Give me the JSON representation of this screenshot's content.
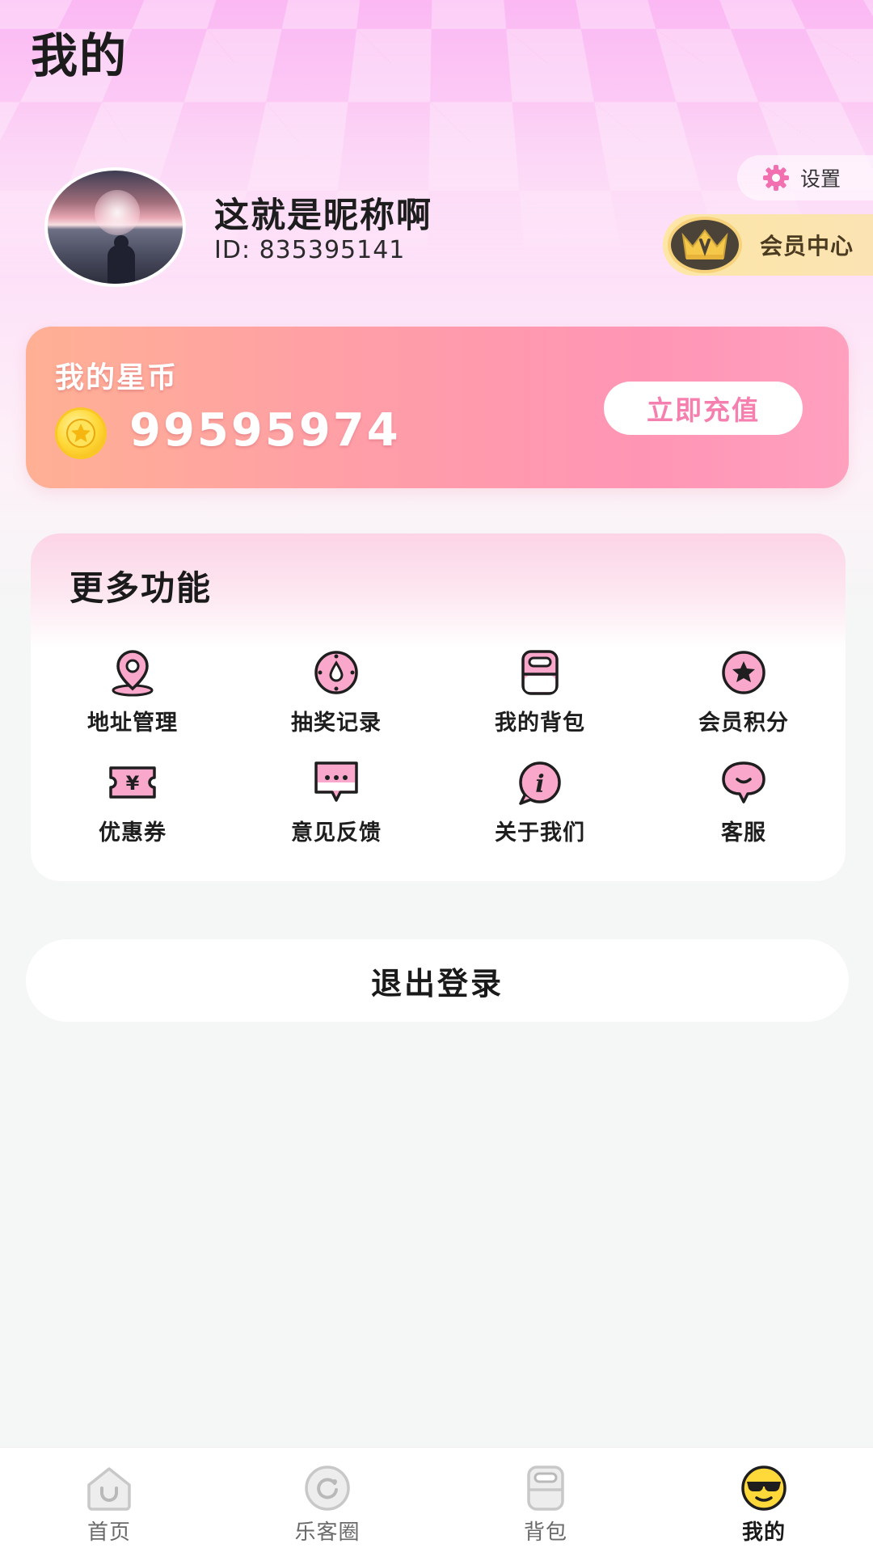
{
  "header": {
    "title": "我的"
  },
  "profile": {
    "nickname": "这就是昵称啊",
    "id_text": "ID: 835395141"
  },
  "settings": {
    "label": "设置",
    "icon": "gear-icon"
  },
  "vip": {
    "label": "会员中心",
    "icon": "crown-icon"
  },
  "coins": {
    "title": "我的星币",
    "amount": "99595974",
    "recharge_label": "立即充值"
  },
  "features": {
    "title": "更多功能",
    "items": [
      {
        "label": "地址管理",
        "icon": "location-pin-icon"
      },
      {
        "label": "抽奖记录",
        "icon": "lottery-icon"
      },
      {
        "label": "我的背包",
        "icon": "backpack-icon"
      },
      {
        "label": "会员积分",
        "icon": "star-points-icon"
      },
      {
        "label": "优惠券",
        "icon": "coupon-icon"
      },
      {
        "label": "意见反馈",
        "icon": "feedback-icon"
      },
      {
        "label": "关于我们",
        "icon": "info-icon"
      },
      {
        "label": "客服",
        "icon": "customer-service-icon"
      }
    ]
  },
  "logout": {
    "label": "退出登录"
  },
  "tabbar": {
    "items": [
      {
        "label": "首页",
        "icon": "home-icon"
      },
      {
        "label": "乐客圈",
        "icon": "circle-icon"
      },
      {
        "label": "背包",
        "icon": "bag-icon"
      },
      {
        "label": "我的",
        "icon": "profile-cool-icon"
      }
    ],
    "active_index": 3
  },
  "colors": {
    "accent_pink": "#f57fae",
    "coin_card_start": "#ffb094",
    "coin_card_end": "#ffa0bf",
    "vip_gold": "#fde6a6",
    "icon_pink": "#f9a8cc"
  }
}
